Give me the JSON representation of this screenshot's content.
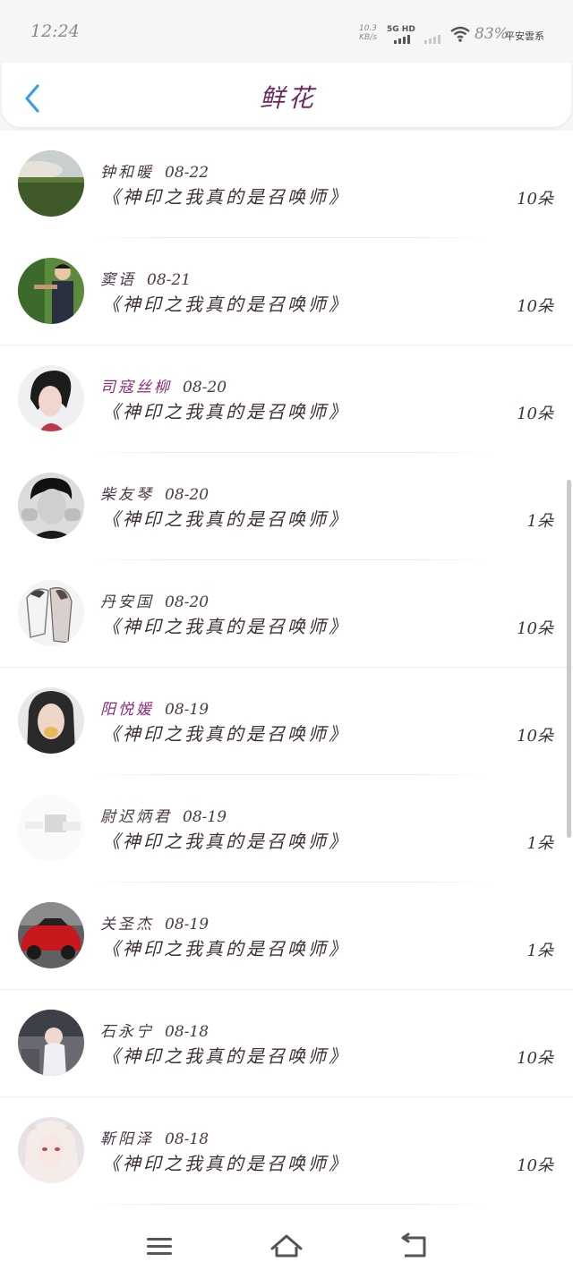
{
  "status_bar": {
    "time": "12:24",
    "net_speed_value": "10.3",
    "net_speed_unit": "KB/s",
    "network": "5G HD",
    "battery": "83%",
    "carrier": "平安雲系"
  },
  "header": {
    "title": "鲜花"
  },
  "flowers": [
    {
      "name": "钟和暖",
      "date": "08-22",
      "book": "《神印之我真的是召唤师》",
      "count": "10朵"
    },
    {
      "name": "窦语",
      "date": "08-21",
      "book": "《神印之我真的是召唤师》",
      "count": "10朵"
    },
    {
      "name": "司寇丝柳",
      "date": "08-20",
      "book": "《神印之我真的是召唤师》",
      "count": "10朵"
    },
    {
      "name": "柴友琴",
      "date": "08-20",
      "book": "《神印之我真的是召唤师》",
      "count": "1朵"
    },
    {
      "name": "丹安国",
      "date": "08-20",
      "book": "《神印之我真的是召唤师》",
      "count": "10朵"
    },
    {
      "name": "阳悦媛",
      "date": "08-19",
      "book": "《神印之我真的是召唤师》",
      "count": "10朵"
    },
    {
      "name": "尉迟炳君",
      "date": "08-19",
      "book": "《神印之我真的是召唤师》",
      "count": "1朵"
    },
    {
      "name": "关圣杰",
      "date": "08-19",
      "book": "《神印之我真的是召唤师》",
      "count": "1朵"
    },
    {
      "name": "石永宁",
      "date": "08-18",
      "book": "《神印之我真的是召唤师》",
      "count": "10朵"
    },
    {
      "name": "靳阳泽",
      "date": "08-18",
      "book": "《神印之我真的是召唤师》",
      "count": "10朵"
    }
  ],
  "colors": {
    "accent_back": "#3a9ee8",
    "title": "#6b2a63",
    "text": "#3d2f3a"
  },
  "icons": {
    "back": "chevron-left-icon",
    "menu": "menu-icon",
    "home": "home-icon",
    "return": "return-icon"
  }
}
